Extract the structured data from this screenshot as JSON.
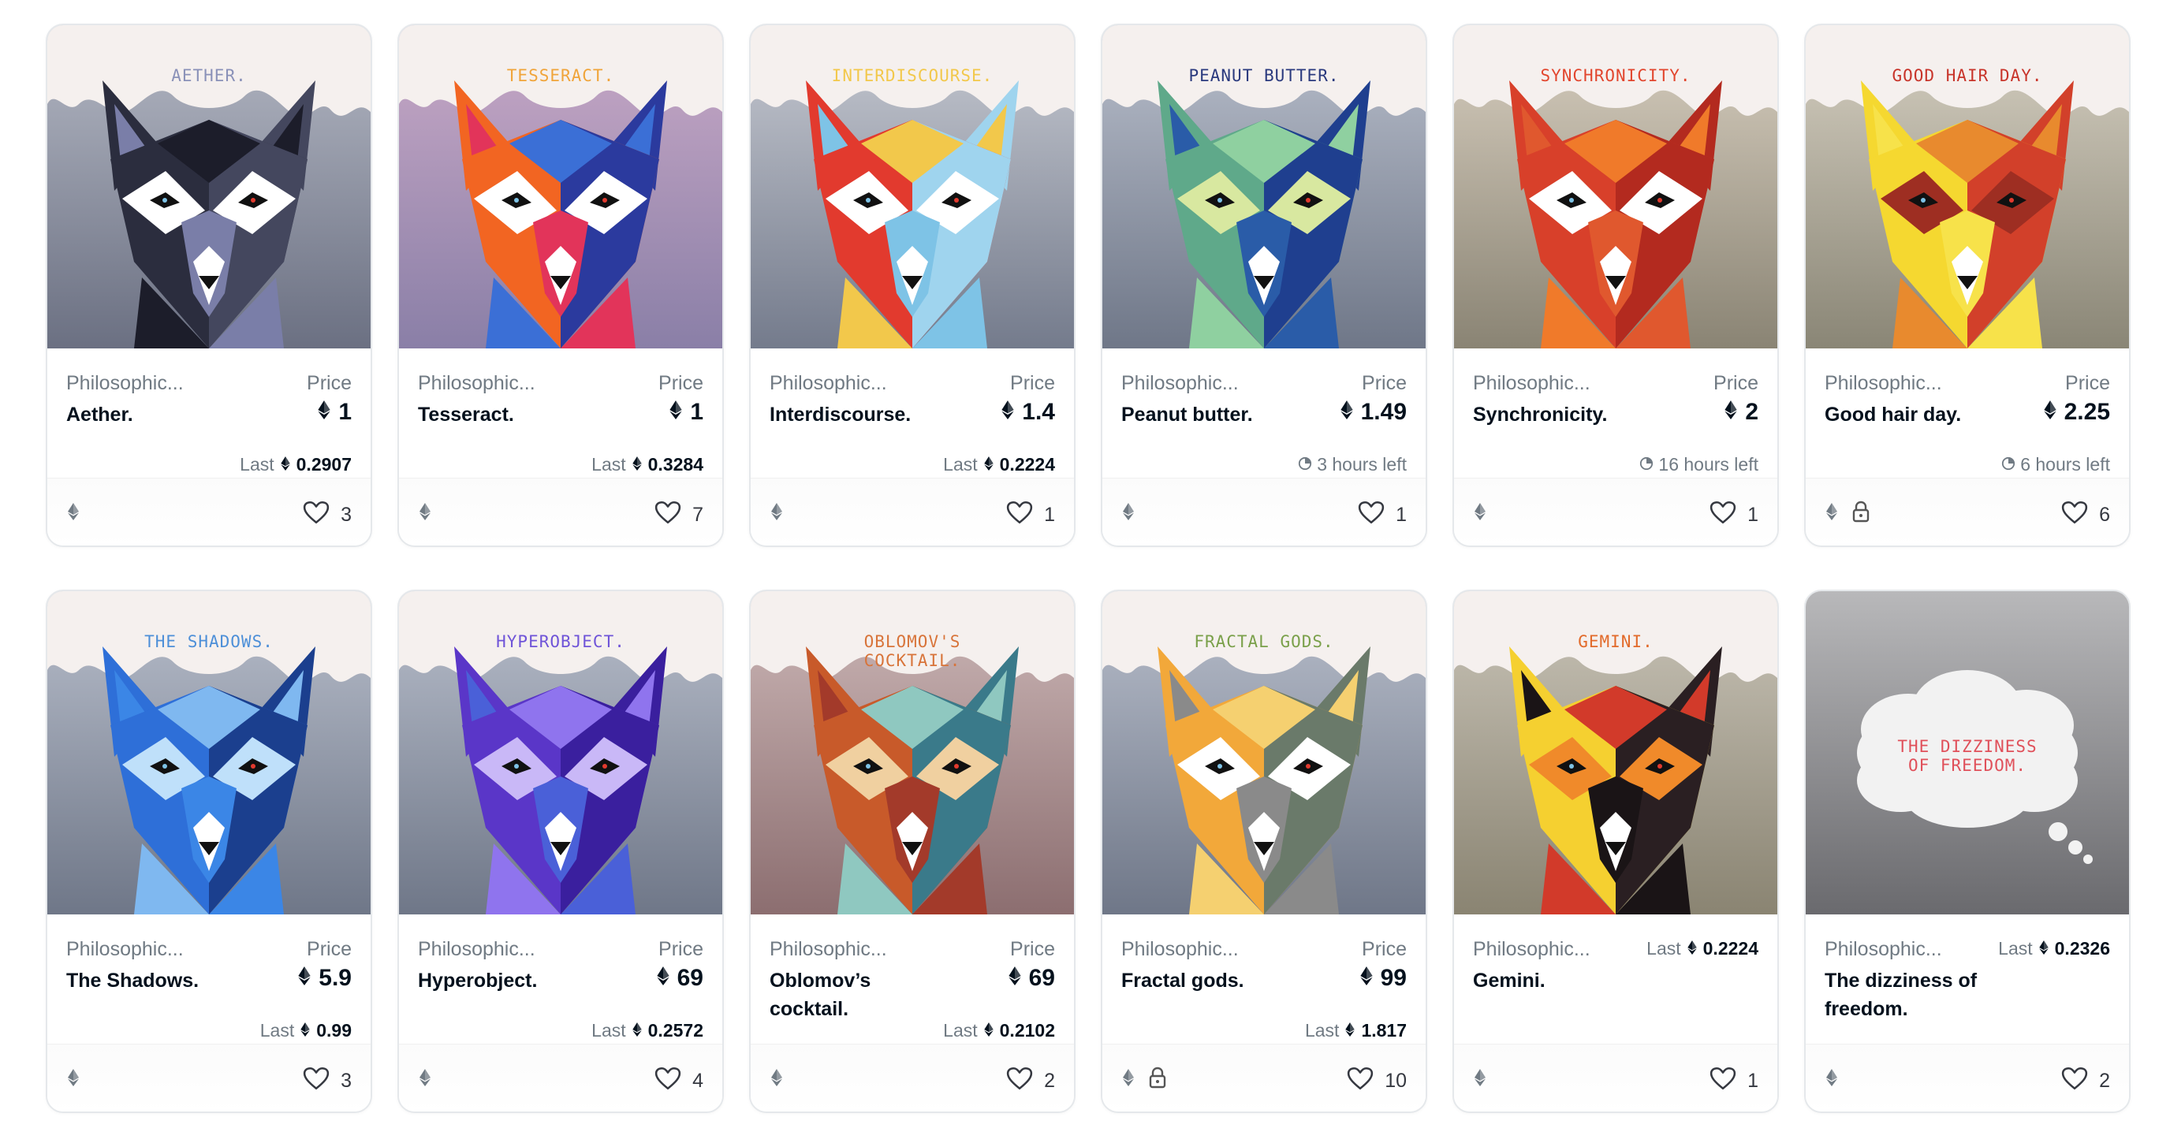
{
  "cards": [
    {
      "art_title": "AETHER.",
      "title_color": "#8a91b8",
      "bg_top": "#b4b8c4",
      "bg_bottom": "#6b7082",
      "fox_colors": [
        "#2b2d3e",
        "#44475e",
        "#1c1d2a",
        "#ffffff",
        "#7a7ea8"
      ],
      "collection": "Philosophic...",
      "name": "Aether.",
      "price_label": "Price",
      "price": "1",
      "last_label": "Last",
      "last_price": "0.2907",
      "time_left": "",
      "likes": "3",
      "locked": false
    },
    {
      "art_title": "TESSERACT.",
      "title_color": "#f0a43a",
      "bg_top": "#c9a9c7",
      "bg_bottom": "#8a7fa7",
      "fox_colors": [
        "#f26522",
        "#2b3a9e",
        "#3b6fd6",
        "#ffffff",
        "#e2345a"
      ],
      "collection": "Philosophic...",
      "name": "Tesseract.",
      "price_label": "Price",
      "price": "1",
      "last_label": "Last",
      "last_price": "0.3284",
      "time_left": "",
      "likes": "7",
      "locked": false
    },
    {
      "art_title": "INTERDISCOURSE.",
      "title_color": "#f2c84b",
      "bg_top": "#c7cad2",
      "bg_bottom": "#747b8c",
      "fox_colors": [
        "#e23a2e",
        "#9fd4ee",
        "#f2c84b",
        "#ffffff",
        "#7ec3e6"
      ],
      "collection": "Philosophic...",
      "name": "Interdiscourse.",
      "price_label": "Price",
      "price": "1.4",
      "last_label": "Last",
      "last_price": "0.2224",
      "time_left": "",
      "likes": "1",
      "locked": false
    },
    {
      "art_title": "PEANUT BUTTER.",
      "title_color": "#2b3a7e",
      "bg_top": "#b9bfcc",
      "bg_bottom": "#6f7788",
      "fox_colors": [
        "#5fa98a",
        "#1f3f8f",
        "#8fd0a0",
        "#d8e8a0",
        "#2a5ca8"
      ],
      "collection": "Philosophic...",
      "name": "Peanut butter.",
      "price_label": "Price",
      "price": "1.49",
      "last_label": "",
      "last_price": "",
      "time_left": "3 hours left",
      "likes": "1",
      "locked": false
    },
    {
      "art_title": "SYNCHRONICITY.",
      "title_color": "#e2462e",
      "bg_top": "#d8cfc0",
      "bg_bottom": "#8a8474",
      "fox_colors": [
        "#d8402a",
        "#b32a1f",
        "#f07a2a",
        "#ffffff",
        "#e0582e"
      ],
      "collection": "Philosophic...",
      "name": "Synchronicity.",
      "price_label": "Price",
      "price": "2",
      "last_label": "",
      "last_price": "",
      "time_left": "16 hours left",
      "likes": "1",
      "locked": false
    },
    {
      "art_title": "GOOD HAIR DAY.",
      "title_color": "#c8342a",
      "bg_top": "#d6d0c2",
      "bg_bottom": "#8a8676",
      "fox_colors": [
        "#f5d830",
        "#d2402a",
        "#e88a2e",
        "#9e2e22",
        "#f7e24a"
      ],
      "collection": "Philosophic...",
      "name": "Good hair day.",
      "price_label": "Price",
      "price": "2.25",
      "last_label": "",
      "last_price": "",
      "time_left": "6 hours left",
      "likes": "6",
      "locked": true
    },
    {
      "art_title": "THE SHADOWS.",
      "title_color": "#4d8fd8",
      "bg_top": "#b9bfcc",
      "bg_bottom": "#6f7788",
      "fox_colors": [
        "#2e6fd8",
        "#1b3f8e",
        "#7fb8f0",
        "#bfe0fa",
        "#3b86e6"
      ],
      "collection": "Philosophic...",
      "name": "The Shadows.",
      "price_label": "Price",
      "price": "5.9",
      "last_label": "Last",
      "last_price": "0.99",
      "time_left": "",
      "likes": "3",
      "locked": false
    },
    {
      "art_title": "HYPEROBJECT.",
      "title_color": "#6f54d8",
      "bg_top": "#b9bfcc",
      "bg_bottom": "#6f7788",
      "fox_colors": [
        "#5a36c8",
        "#3a1f9e",
        "#8f74ee",
        "#c9b8f7",
        "#4a60d8"
      ],
      "collection": "Philosophic...",
      "name": "Hyperobject.",
      "price_label": "Price",
      "price": "69",
      "last_label": "Last",
      "last_price": "0.2572",
      "time_left": "",
      "likes": "4",
      "locked": false
    },
    {
      "art_title": "OBLOMOV'S\nCOCKTAIL.",
      "title_color": "#d8743a",
      "bg_top": "#cdb8b8",
      "bg_bottom": "#8c6e70",
      "fox_colors": [
        "#c85a2a",
        "#3a7a8a",
        "#8fc8c0",
        "#f0d0a0",
        "#a33a2a"
      ],
      "collection": "Philosophic...",
      "name": "Oblomov’s cocktail.",
      "price_label": "Price",
      "price": "69",
      "last_label": "Last",
      "last_price": "0.2102",
      "time_left": "",
      "likes": "2",
      "locked": false
    },
    {
      "art_title": "FRACTAL GODS.",
      "title_color": "#7aa04a",
      "bg_top": "#b9bfcc",
      "bg_bottom": "#6f7788",
      "fox_colors": [
        "#f2a83a",
        "#6a7a6a",
        "#f5d070",
        "#ffffff",
        "#8a8a8a"
      ],
      "collection": "Philosophic...",
      "name": "Fractal gods.",
      "price_label": "Price",
      "price": "99",
      "last_label": "Last",
      "last_price": "1.817",
      "time_left": "",
      "likes": "10",
      "locked": true
    },
    {
      "art_title": "GEMINI.",
      "title_color": "#e26a2a",
      "bg_top": "#c9c4b8",
      "bg_bottom": "#8a8472",
      "fox_colors": [
        "#f5d030",
        "#2a1f22",
        "#d23a2a",
        "#f08a2a",
        "#1a1416"
      ],
      "collection": "Philosophic...",
      "name": "Gemini.",
      "price_label": "",
      "price": "",
      "last_label": "Last",
      "last_price": "0.2224",
      "time_left": "",
      "likes": "1",
      "locked": false
    },
    {
      "art_title": "THE DIZZINESS\nOF FREEDOM.",
      "title_color": "#e0505a",
      "bg_top": "#b8b8ba",
      "bg_bottom": "#6a6a6e",
      "fox_colors": [],
      "collection": "Philosophic...",
      "name": "The dizziness of freedom.",
      "price_label": "",
      "price": "",
      "last_label": "Last",
      "last_price": "0.2326",
      "time_left": "",
      "likes": "2",
      "locked": false
    }
  ]
}
